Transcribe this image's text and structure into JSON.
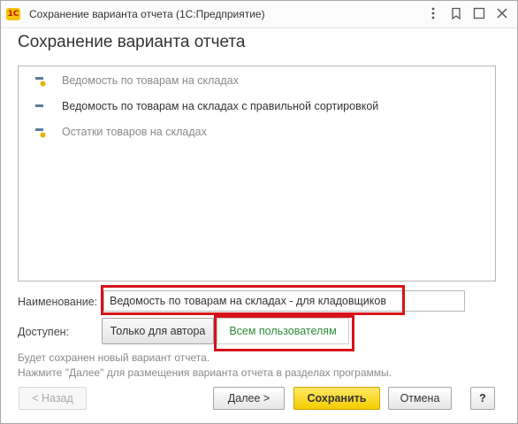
{
  "window": {
    "app_icon": "1С",
    "title": "Сохранение варианта отчета  (1С:Предприятие)",
    "controls": [
      "menu-icon",
      "bookmark-icon",
      "resize-icon",
      "close-icon"
    ]
  },
  "dialog": {
    "title": "Сохранение варианта отчета"
  },
  "variants": [
    {
      "label": "Ведомость по товарам на складах",
      "icon": "report-variant-icon",
      "color": "#8a8a8a"
    },
    {
      "label": "Ведомость по товарам на складах с правильной сортировкой",
      "icon": "report-variant-new-icon",
      "color": "#333333"
    },
    {
      "label": "Остатки товаров на складах",
      "icon": "report-variant-icon",
      "color": "#8a8a8a"
    }
  ],
  "form": {
    "name_label": "Наименование:",
    "name_value": "Ведомость по товарам на складах - для кладовщиков",
    "available_label": "Доступен:",
    "options": [
      {
        "label": "Только для автора",
        "selected": false
      },
      {
        "label": "Всем пользователям",
        "selected": true
      }
    ]
  },
  "info": {
    "line1": "Будет сохранен новый вариант отчета.",
    "line2": "Нажмите \"Далее\" для размещения варианта отчета в разделах программы."
  },
  "buttons": {
    "back": "< Назад",
    "next": "Далее >",
    "save": "Сохранить",
    "cancel": "Отмена",
    "help": "?"
  },
  "colors": {
    "highlight": "#d7131a",
    "save_button": "#f4cc00",
    "selected_option_text": "#2e8b3a",
    "variant_icon_bar": "#5a7a9a",
    "variant_icon_dot": "#e8b400"
  }
}
